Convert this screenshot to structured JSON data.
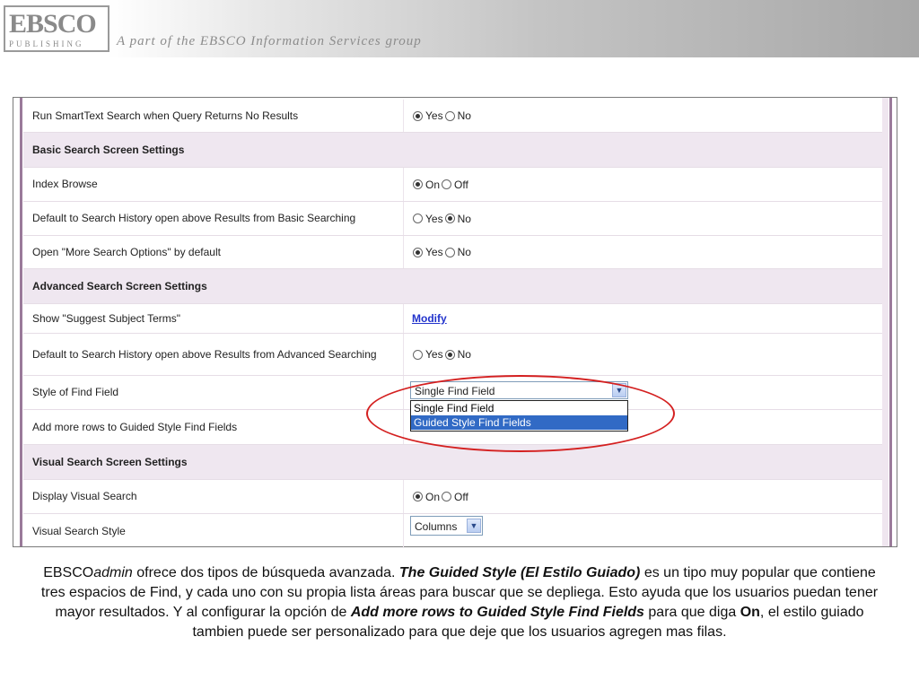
{
  "banner": {
    "logo_main": "EBSCO",
    "logo_sub": "PUBLISHING",
    "tagline": "A part of the EBSCO Information Services group"
  },
  "settings": {
    "run_smarttext": {
      "label": "Run SmartText Search when Query Returns No Results",
      "opt1": "Yes",
      "opt2": "No",
      "selected": "Yes"
    },
    "basic_header": "Basic Search Screen Settings",
    "index_browse": {
      "label": "Index Browse",
      "opt1": "On",
      "opt2": "Off",
      "selected": "On"
    },
    "basic_history": {
      "label": "Default to Search History open above Results from Basic Searching",
      "opt1": "Yes",
      "opt2": "No",
      "selected": "No"
    },
    "more_options": {
      "label": "Open \"More Search Options\" by default",
      "opt1": "Yes",
      "opt2": "No",
      "selected": "Yes"
    },
    "advanced_header": "Advanced Search Screen Settings",
    "suggest_terms": {
      "label": "Show \"Suggest Subject Terms\"",
      "link": "Modify"
    },
    "adv_history": {
      "label": "Default to Search History open above Results from Advanced Searching",
      "opt1": "Yes",
      "opt2": "No",
      "selected": "No"
    },
    "find_style": {
      "label": "Style of Find Field",
      "value": "Single Find Field",
      "options": [
        "Single Find Field",
        "Guided Style Find Fields"
      ],
      "highlighted": "Guided Style Find Fields"
    },
    "guided_rows": {
      "label": "Add more rows to Guided Style Find Fields"
    },
    "visual_header": "Visual Search Screen Settings",
    "display_visual": {
      "label": "Display Visual Search",
      "opt1": "On",
      "opt2": "Off",
      "selected": "On"
    },
    "visual_style": {
      "label": "Visual Search Style",
      "value": "Columns"
    }
  },
  "caption": {
    "p1": "EBSCO",
    "p1_italic": "admin",
    "p2": " ofrece dos tipos de búsqueda avanzada.  ",
    "p3_bold_italic": "The Guided Style (El Estilo Guiado)",
    "p4": " es un tipo muy popular que contiene tres espacios de Find, y cada uno con su propia lista áreas para buscar que se depliega. Esto ayuda que los usuarios puedan tener mayor resultados. Y al configurar la opción de ",
    "p5_bold_italic": "Add more rows to Guided Style Find Fields",
    "p6": "  para que diga ",
    "p7_bold": "On",
    "p8": ",  el estilo guiado tambien puede ser personalizado para que deje que los usuarios agregen mas filas."
  },
  "colors": {
    "accent_ring": "#d42020",
    "header_row": "#efe7f0",
    "link": "#2233cc",
    "selection": "#316ac5"
  }
}
